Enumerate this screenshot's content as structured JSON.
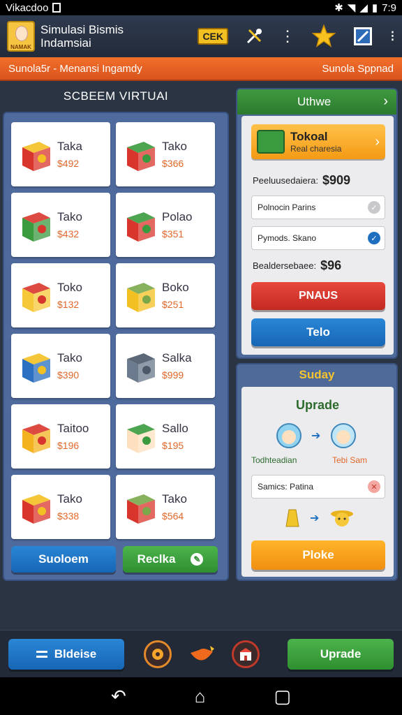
{
  "status_bar": {
    "carrier": "Vikacdoo",
    "time": "7:9",
    "icons": [
      "notification-icon",
      "bluetooth-icon",
      "wifi-icon",
      "signal-icon",
      "battery-icon"
    ]
  },
  "app_bar": {
    "title": "Simulasi Bismis Indamsiai",
    "logo_text": "NAMAK",
    "cek_label": "CEK",
    "icons": [
      "tools-icon",
      "more-vert-icon",
      "star-icon",
      "edit-icon",
      "overflow-icon"
    ]
  },
  "banner": {
    "left": "Sunola5r - Menansi Ingamdy",
    "right": "Sunola Sppnad"
  },
  "left_panel": {
    "title": "SCBEEM VIRTUAI",
    "products": [
      {
        "name": "Taka",
        "price": "$492",
        "icon": "gift-box-red-icon"
      },
      {
        "name": "Tako",
        "price": "$366",
        "icon": "shop-box-red-icon"
      },
      {
        "name": "Tako",
        "price": "$432",
        "icon": "gift-box-green-icon"
      },
      {
        "name": "Polao",
        "price": "$351",
        "icon": "shop-box-red-icon"
      },
      {
        "name": "Toko",
        "price": "$132",
        "icon": "box-yellow-icon"
      },
      {
        "name": "Boko",
        "price": "$251",
        "icon": "shopper-cart-icon"
      },
      {
        "name": "Tako",
        "price": "$390",
        "icon": "shopping-bag-blue-icon"
      },
      {
        "name": "Salka",
        "price": "$999",
        "icon": "cart-gray-icon"
      },
      {
        "name": "Taitoo",
        "price": "$196",
        "icon": "shopping-bag-yellow-icon"
      },
      {
        "name": "Sallo",
        "price": "$195",
        "icon": "chef-icon"
      },
      {
        "name": "Tako",
        "price": "$338",
        "icon": "gift-box-red-icon"
      },
      {
        "name": "Tako",
        "price": "$564",
        "icon": "cart-red-icon"
      }
    ],
    "btn_left": "Suoloem",
    "btn_right": "Reclka"
  },
  "right_panel": {
    "header": "Uthwe",
    "card_title": "Tokoal",
    "card_sub": "Real charesia",
    "line1_label": "Peeluusedaiera:",
    "line1_value": "$909",
    "option1": "Polnocin Parins",
    "option2": "Pymods. Skano",
    "line2_label": "Bealdersebaee:",
    "line2_value": "$96",
    "btn_red": "PNAUS",
    "btn_blue": "Telo"
  },
  "upgrade_panel": {
    "header": "Suday",
    "title": "Uprade",
    "cap_left": "Todhteadian",
    "cap_right": "Tebi Sam",
    "option": "Samics: Patina"
  },
  "bottom_bar": {
    "left_btn": "Bldeise",
    "right_btn": "Uprade"
  },
  "colors": {
    "orange": "#e8632a",
    "green": "#3a9a3e",
    "blue": "#1f75c8",
    "red": "#d8362c",
    "panel": "#4f6a9c"
  }
}
